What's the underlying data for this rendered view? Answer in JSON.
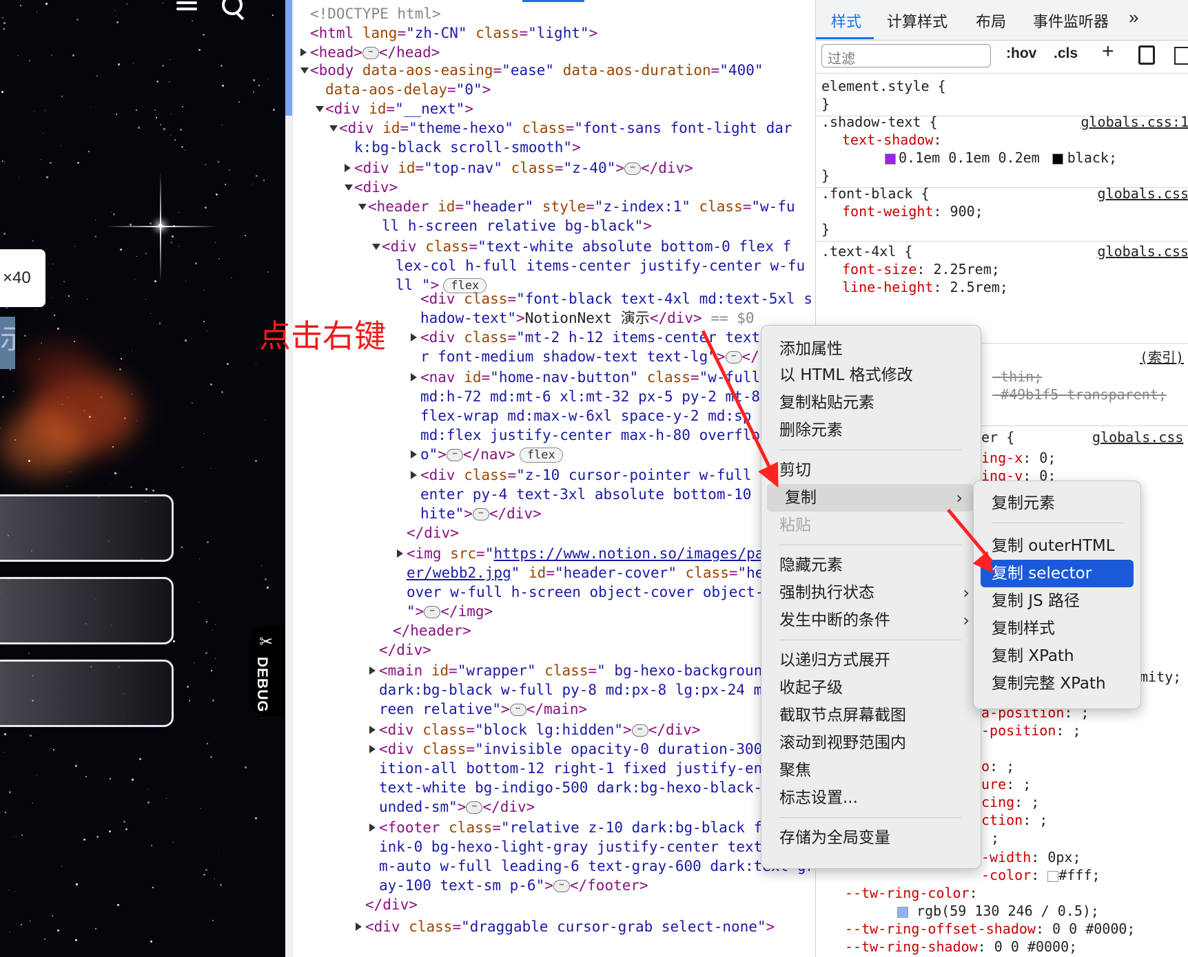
{
  "preview": {
    "zoom_badge": "×40",
    "title_fragment": "示",
    "debug_label": "DEBUG",
    "debug_icon": "✂"
  },
  "elements": {
    "selection_annotation": "点击右键",
    "lines": [
      {
        "parts": [
          [
            "com",
            "<!DOCTYPE html>"
          ]
        ]
      },
      {
        "parts": [
          [
            "tag",
            "<html "
          ],
          [
            "an",
            "lang"
          ],
          [
            "tag",
            "="
          ],
          [
            "av",
            "\"zh-CN\" "
          ],
          [
            "an",
            "class"
          ],
          [
            "tag",
            "="
          ],
          [
            "av",
            "\"light\""
          ],
          [
            "tag",
            ">"
          ]
        ]
      },
      {
        "parts": [
          [
            "tag",
            "<head>"
          ],
          [
            "ell",
            "⋯"
          ],
          [
            "tag",
            "</head>"
          ]
        ]
      },
      {
        "parts": [
          [
            "tag",
            "<body "
          ],
          [
            "an",
            "data-aos-easing"
          ],
          [
            "tag",
            "="
          ],
          [
            "av",
            "\"ease\" "
          ],
          [
            "an",
            "data-aos-duration"
          ],
          [
            "tag",
            "="
          ],
          [
            "av",
            "\"400\""
          ]
        ]
      },
      {
        "parts": [
          [
            "an",
            "data-aos-delay"
          ],
          [
            "tag",
            "="
          ],
          [
            "av",
            "\"0\""
          ],
          [
            "tag",
            ">"
          ]
        ]
      },
      {
        "parts": [
          [
            "tag",
            "<div "
          ],
          [
            "an",
            "id"
          ],
          [
            "tag",
            "="
          ],
          [
            "av",
            "\"__next\""
          ],
          [
            "tag",
            ">"
          ]
        ]
      },
      {
        "parts": [
          [
            "tag",
            "<div "
          ],
          [
            "an",
            "id"
          ],
          [
            "tag",
            "="
          ],
          [
            "av",
            "\"theme-hexo\" "
          ],
          [
            "an",
            "class"
          ],
          [
            "tag",
            "="
          ],
          [
            "av",
            "\"font-sans font-light dar"
          ]
        ]
      },
      {
        "parts": [
          [
            "av",
            "k:bg-black scroll-smooth\""
          ],
          [
            "tag",
            ">"
          ]
        ]
      },
      {
        "parts": [
          [
            "tag",
            "<div "
          ],
          [
            "an",
            "id"
          ],
          [
            "tag",
            "="
          ],
          [
            "av",
            "\"top-nav\" "
          ],
          [
            "an",
            "class"
          ],
          [
            "tag",
            "="
          ],
          [
            "av",
            "\"z-40\""
          ],
          [
            "tag",
            ">"
          ],
          [
            "ell",
            "⋯"
          ],
          [
            "tag",
            "</div>"
          ]
        ]
      },
      {
        "parts": [
          [
            "tag",
            "<div>"
          ]
        ]
      },
      {
        "parts": [
          [
            "tag",
            "<header "
          ],
          [
            "an",
            "id"
          ],
          [
            "tag",
            "="
          ],
          [
            "av",
            "\"header\" "
          ],
          [
            "an",
            "style"
          ],
          [
            "tag",
            "="
          ],
          [
            "av",
            "\"z-index:1\" "
          ],
          [
            "an",
            "class"
          ],
          [
            "tag",
            "="
          ],
          [
            "av",
            "\"w-fu"
          ]
        ]
      },
      {
        "parts": [
          [
            "av",
            "ll h-screen relative bg-black\""
          ],
          [
            "tag",
            ">"
          ]
        ]
      },
      {
        "parts": [
          [
            "tag",
            "<div "
          ],
          [
            "an",
            "class"
          ],
          [
            "tag",
            "="
          ],
          [
            "av",
            "\"text-white absolute bottom-0 flex f"
          ]
        ]
      },
      {
        "parts": [
          [
            "av",
            "lex-col h-full items-center justify-center w-fu"
          ]
        ]
      },
      {
        "parts": [
          [
            "av",
            "ll \""
          ],
          [
            "tag",
            ">"
          ],
          [
            "pill",
            "flex"
          ]
        ]
      },
      {
        "parts": [
          [
            "tag",
            "<div "
          ],
          [
            "an",
            "class"
          ],
          [
            "tag",
            "="
          ],
          [
            "av",
            "\"font-black text-4xl md:text-5xl s"
          ]
        ]
      },
      {
        "parts": [
          [
            "av",
            "hadow-text\""
          ],
          [
            "tag",
            ">"
          ],
          [
            "txt",
            "NotionNext 演示"
          ],
          [
            "tag",
            "</div>"
          ],
          [
            "com",
            " == $0"
          ]
        ]
      },
      {
        "parts": [
          [
            "tag",
            "<div "
          ],
          [
            "an",
            "class"
          ],
          [
            "tag",
            "="
          ],
          [
            "av",
            "\"mt-2 h-12 items-center text-"
          ]
        ]
      },
      {
        "parts": [
          [
            "av",
            "r font-medium shadow-text text-lg\""
          ],
          [
            "tag",
            ">"
          ],
          [
            "ell",
            "⋯"
          ],
          [
            "tag",
            "</"
          ]
        ]
      },
      {
        "parts": [
          [
            "tag",
            "<nav "
          ],
          [
            "an",
            "id"
          ],
          [
            "tag",
            "="
          ],
          [
            "av",
            "\"home-nav-button\" "
          ],
          [
            "an",
            "class"
          ],
          [
            "tag",
            "="
          ],
          [
            "av",
            "\"w-full"
          ]
        ]
      },
      {
        "parts": [
          [
            "av",
            "md:h-72 md:mt-6 xl:mt-32 px-5 py-2 mt-8"
          ]
        ]
      },
      {
        "parts": [
          [
            "av",
            "flex-wrap md:max-w-6xl space-y-2 md:sp"
          ]
        ]
      },
      {
        "parts": [
          [
            "av",
            "md:flex justify-center max-h-80 overflo"
          ]
        ]
      },
      {
        "parts": [
          [
            "av",
            "o\""
          ],
          [
            "tag",
            ">"
          ],
          [
            "ell",
            "⋯"
          ],
          [
            "tag",
            "</nav>"
          ],
          [
            "pill",
            "flex"
          ]
        ]
      },
      {
        "parts": [
          [
            "tag",
            "<div "
          ],
          [
            "an",
            "class"
          ],
          [
            "tag",
            "="
          ],
          [
            "av",
            "\"z-10 cursor-pointer w-full t"
          ]
        ]
      },
      {
        "parts": [
          [
            "av",
            "enter py-4 text-3xl absolute bottom-10 t"
          ]
        ]
      },
      {
        "parts": [
          [
            "av",
            "hite\""
          ],
          [
            "tag",
            ">"
          ],
          [
            "ell",
            "⋯"
          ],
          [
            "tag",
            "</div>"
          ]
        ]
      },
      {
        "parts": [
          [
            "tag",
            "</div>"
          ]
        ]
      },
      {
        "parts": [
          [
            "tag",
            "<img "
          ],
          [
            "an",
            "src"
          ],
          [
            "tag",
            "="
          ],
          [
            "av",
            "\""
          ],
          [
            "url",
            "https://www.notion.so/images/pag"
          ]
        ]
      },
      {
        "parts": [
          [
            "url",
            "er/webb2.jpg"
          ],
          [
            "av",
            "\" "
          ],
          [
            "an",
            "id"
          ],
          [
            "tag",
            "="
          ],
          [
            "av",
            "\"header-cover\" "
          ],
          [
            "an",
            "class"
          ],
          [
            "tag",
            "="
          ],
          [
            "av",
            "\"hea"
          ]
        ]
      },
      {
        "parts": [
          [
            "av",
            "over w-full h-screen object-cover object-c"
          ]
        ]
      },
      {
        "parts": [
          [
            "av",
            "\""
          ],
          [
            "tag",
            ">"
          ],
          [
            "ell",
            "⋯"
          ],
          [
            "tag",
            "</img>"
          ]
        ]
      },
      {
        "parts": [
          [
            "tag",
            "</header>"
          ]
        ]
      },
      {
        "parts": [
          [
            "tag",
            "</div>"
          ]
        ]
      },
      {
        "parts": [
          [
            "tag",
            "<main "
          ],
          [
            "an",
            "id"
          ],
          [
            "tag",
            "="
          ],
          [
            "av",
            "\"wrapper\" "
          ],
          [
            "an",
            "class"
          ],
          [
            "tag",
            "="
          ],
          [
            "av",
            "\" bg-hexo-background"
          ]
        ]
      },
      {
        "parts": [
          [
            "av",
            "dark:bg-black w-full py-8 md:px-8 lg:px-24 mi"
          ]
        ]
      },
      {
        "parts": [
          [
            "av",
            "reen relative\""
          ],
          [
            "tag",
            ">"
          ],
          [
            "ell",
            "⋯"
          ],
          [
            "tag",
            "</main>"
          ]
        ]
      },
      {
        "parts": [
          [
            "tag",
            "<div "
          ],
          [
            "an",
            "class"
          ],
          [
            "tag",
            "="
          ],
          [
            "av",
            "\"block lg:hidden\""
          ],
          [
            "tag",
            ">"
          ],
          [
            "ell",
            "⋯"
          ],
          [
            "tag",
            "</div>"
          ]
        ]
      },
      {
        "parts": [
          [
            "tag",
            "<div "
          ],
          [
            "an",
            "class"
          ],
          [
            "tag",
            "="
          ],
          [
            "av",
            "\"invisible opacity-0  duration-300"
          ]
        ]
      },
      {
        "parts": [
          [
            "av",
            "ition-all bottom-12 right-1 fixed justify-end"
          ]
        ]
      },
      {
        "parts": [
          [
            "av",
            "text-white bg-indigo-500 dark:bg-hexo-black-g"
          ]
        ]
      },
      {
        "parts": [
          [
            "av",
            "unded-sm\""
          ],
          [
            "tag",
            ">"
          ],
          [
            "ell",
            "⋯"
          ],
          [
            "tag",
            "</div>"
          ]
        ]
      },
      {
        "parts": [
          [
            "tag",
            "<footer "
          ],
          [
            "an",
            "class"
          ],
          [
            "tag",
            "="
          ],
          [
            "av",
            "\"relative z-10 dark:bg-black fl"
          ]
        ]
      },
      {
        "parts": [
          [
            "av",
            "ink-0 bg-hexo-light-gray justify-center text-center"
          ]
        ]
      },
      {
        "parts": [
          [
            "av",
            "m-auto w-full leading-6  text-gray-600 dark:text-gr"
          ]
        ]
      },
      {
        "parts": [
          [
            "av",
            "ay-100 text-sm p-6\""
          ],
          [
            "tag",
            ">"
          ],
          [
            "ell",
            "⋯"
          ],
          [
            "tag",
            "</footer>"
          ]
        ]
      },
      {
        "parts": [
          [
            "tag",
            "</div>"
          ]
        ]
      },
      {
        "parts": [
          [
            "tag",
            "<div "
          ],
          [
            "an",
            "class"
          ],
          [
            "tag",
            "="
          ],
          [
            "av",
            "\"draggable cursor-grab select-none\""
          ],
          [
            "tag",
            ">"
          ]
        ]
      }
    ]
  },
  "styles_panel": {
    "tabs": [
      "样式",
      "计算样式",
      "布局",
      "事件监听器",
      "»"
    ],
    "filter_placeholder": "过滤",
    "tools": [
      ":hov",
      ".cls",
      "+"
    ],
    "rules": [
      {
        "selector": "element.style {",
        "source": "",
        "props": [],
        "close": "}"
      },
      {
        "selector": ".shadow-text {",
        "source": "globals.css:1",
        "props": [
          [
            "text-shadow",
            ":"
          ],
          [
            "",
            "0.1em 0.1em 0.2em  black;"
          ]
        ],
        "close": "}"
      },
      {
        "selector": ".font-black {",
        "source": "globals.css",
        "props": [
          [
            "font-weight",
            ": 900;"
          ]
        ],
        "close": "}"
      },
      {
        "selector": ".text-4xl {",
        "source": "globals.css",
        "props": [
          [
            "font-size",
            ": 2.25rem;"
          ],
          [
            "line-height",
            ": 2.5rem;"
          ]
        ],
        "close": ""
      }
    ],
    "fragments": {
      "index_link": "(索引)",
      "strike1": "-thin;",
      "strike2": "-#49b1f5 transparent;",
      "er_sel": "er {",
      "globals3": "globals.css",
      "ring_x": "ing-x",
      "ring_x_val": ": 0;",
      "ring_y": "ing-y",
      "ring_y_val": ": 0;",
      "mity": "mity;",
      "a_pos": "a-position",
      "a_pos_val": ": ;",
      "pos": "-position",
      "pos_val": ": ;",
      "o": "o",
      "o_val": ": ;",
      "ure": "ure",
      "ure_val": ": ;",
      "cing": "cing",
      "cing_val": ": ;",
      "ction": "ction",
      "ction_val": ": ;",
      "semi": ";",
      "width": "-width",
      "width_val": ": 0px;",
      "color": "-color",
      "color_val": "#fff;",
      "ring_color": "--tw-ring-color",
      "ring_color_val": "rgb(59 130 246 / 0.5);",
      "offset_shadow": "--tw-ring-offset-shadow",
      "offset_shadow_val": "0 0  #0000;",
      "ring_shadow": "--tw-ring-shadow",
      "ring_shadow_val": "0 0  #0000;"
    }
  },
  "context_menu": {
    "items": [
      {
        "label": "添加属性"
      },
      {
        "label": "以 HTML 格式修改"
      },
      {
        "label": "复制粘贴元素"
      },
      {
        "label": "删除元素"
      },
      {
        "label": "剪切"
      },
      {
        "label": "复制",
        "submenu": true,
        "highlight": true
      },
      {
        "label": "粘贴",
        "disabled": true
      },
      {
        "label": "隐藏元素"
      },
      {
        "label": "强制执行状态",
        "submenu": true
      },
      {
        "label": "发生中断的条件",
        "submenu": true
      },
      {
        "label": "以递归方式展开"
      },
      {
        "label": "收起子级"
      },
      {
        "label": "截取节点屏幕截图"
      },
      {
        "label": "滚动到视野范围内"
      },
      {
        "label": "聚焦"
      },
      {
        "label": "标志设置..."
      },
      {
        "label": "存储为全局变量"
      }
    ]
  },
  "copy_submenu": {
    "items": [
      {
        "label": "复制元素"
      },
      {
        "label": "复制 outerHTML"
      },
      {
        "label": "复制 selector",
        "selected": true
      },
      {
        "label": "复制 JS 路径"
      },
      {
        "label": "复制样式"
      },
      {
        "label": "复制 XPath"
      },
      {
        "label": "复制完整 XPath"
      }
    ]
  },
  "colors": {
    "accent": "#1a73e8",
    "selection": "#1a5ad9",
    "annotation": "#f21a1a"
  }
}
